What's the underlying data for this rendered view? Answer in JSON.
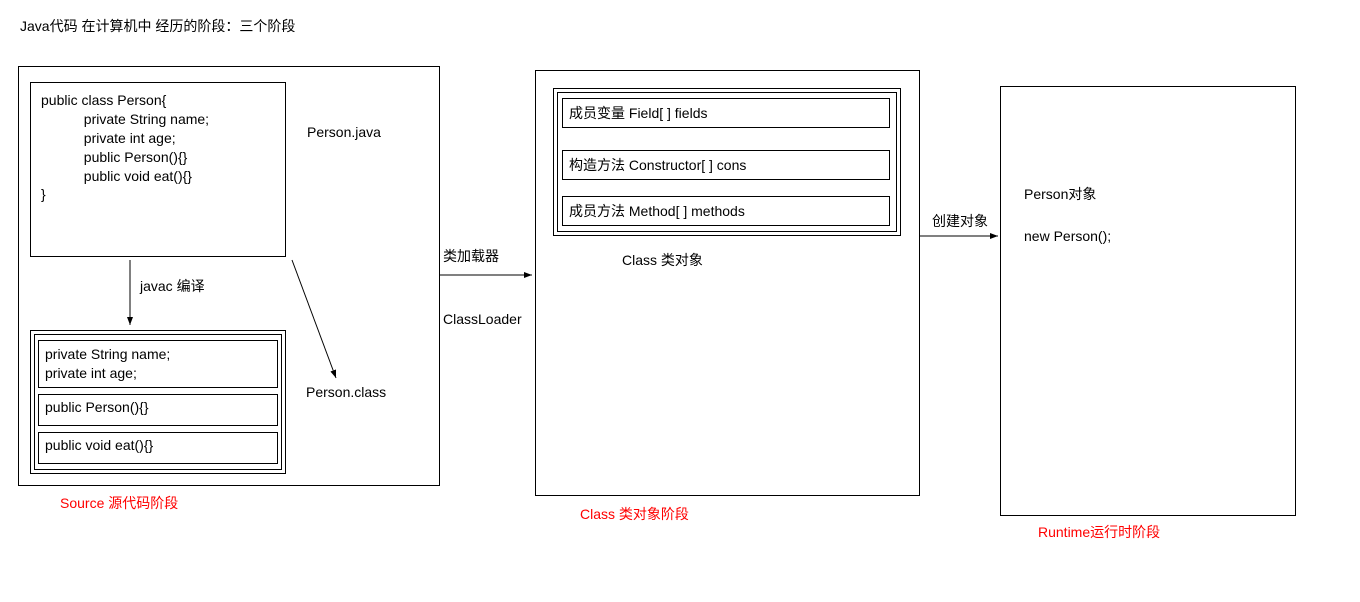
{
  "title": "Java代码 在计算机中 经历的阶段：三个阶段",
  "source": {
    "code": {
      "l1": "public class Person{",
      "l2": "           private String name;",
      "l3": "           private int age;",
      "l4": "",
      "l5": "           public Person(){}",
      "l6": "",
      "l7": "           public void eat(){}",
      "l8": "}"
    },
    "file_java": "Person.java",
    "compile_label": "javac 编译",
    "file_class": "Person.class",
    "class_block": {
      "fields1": "private String name;",
      "fields2": "private int age;",
      "ctor": "public Person(){}",
      "method": "public void eat(){}"
    },
    "stage_label": "Source 源代码阶段"
  },
  "loader": {
    "l1": "类加载器",
    "l2": "ClassLoader"
  },
  "classobj": {
    "row1": "成员变量  Field[ ] fields",
    "row2": "构造方法  Constructor[ ] cons",
    "row3": "成员方法 Method[ ] methods",
    "caption": "Class 类对象",
    "stage_label": "Class 类对象阶段"
  },
  "create_label": "创建对象",
  "runtime": {
    "l1": "Person对象",
    "l2": "new Person();",
    "stage_label": "Runtime运行时阶段"
  }
}
